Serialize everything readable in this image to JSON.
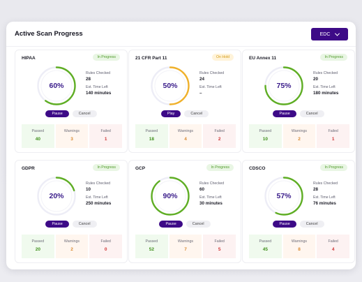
{
  "header": {
    "title": "Active Scan Progress",
    "dropdown_label": "EDC"
  },
  "colors": {
    "brand": "#3d0a87",
    "progress": "#5fae24",
    "hold": "#f0b12a",
    "track": "#ededf6"
  },
  "labels": {
    "rules_checked": "Rules Checked",
    "time_left": "Est. Time Left",
    "passed": "Passed",
    "warnings": "Warnings",
    "failed": "Failed",
    "cancel": "Cancel"
  },
  "cards": [
    {
      "name": "HIPAA",
      "status": "In Progress",
      "status_type": "progress",
      "percent": 60,
      "percent_label": "60%",
      "rules_checked": "28",
      "time_left": "140 minutes",
      "action": "Pause",
      "passed": "40",
      "warnings": "3",
      "failed": "1"
    },
    {
      "name": "21 CFR Part 11",
      "status": "On Hold",
      "status_type": "hold",
      "percent": 50,
      "percent_label": "50%",
      "rules_checked": "24",
      "time_left": "–",
      "action": "Play",
      "passed": "18",
      "warnings": "4",
      "failed": "2"
    },
    {
      "name": "EU Annex 11",
      "status": "In Progress",
      "status_type": "progress",
      "percent": 75,
      "percent_label": "75%",
      "rules_checked": "20",
      "time_left": "180 minutes",
      "action": "Pause",
      "passed": "10",
      "warnings": "2",
      "failed": "1"
    },
    {
      "name": "GDPR",
      "status": "In Progress",
      "status_type": "progress",
      "percent": 20,
      "percent_label": "20%",
      "rules_checked": "10",
      "time_left": "250 minutes",
      "action": "Pause",
      "passed": "20",
      "warnings": "2",
      "failed": "0"
    },
    {
      "name": "GCP",
      "status": "In Progress",
      "status_type": "progress",
      "percent": 90,
      "percent_label": "90%",
      "rules_checked": "60",
      "time_left": "30 minutes",
      "action": "Pause",
      "passed": "52",
      "warnings": "7",
      "failed": "5"
    },
    {
      "name": "CDSCO",
      "status": "In Progress",
      "status_type": "progress",
      "percent": 57,
      "percent_label": "57%",
      "rules_checked": "28",
      "time_left": "76 minutes",
      "action": "Pause",
      "passed": "45",
      "warnings": "8",
      "failed": "4"
    }
  ]
}
